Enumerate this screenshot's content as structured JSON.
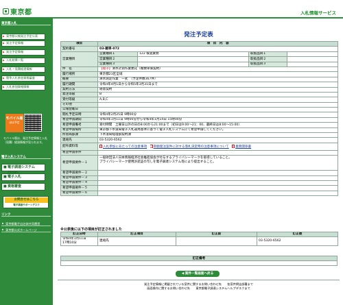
{
  "header": {
    "logo_text": "東京都",
    "service_title": "入札情報サービス"
  },
  "sidebar": {
    "section1_label": "東京都入札",
    "items": [
      "東京都公報発注予定公表",
      "発注予定情報",
      "発注予定情報",
      "入札結果一覧",
      "入札・見積経過情報",
      "競争入札参加資格審査",
      "入札参加資格情報"
    ],
    "mobile_label": "モバイル版",
    "mobile_sub": "ほぼ予定",
    "note": "モバイル版は、発注予定情報と入札（見積）経過情報が見られます。",
    "section2_label": "電子入札システム",
    "big_items": [
      "電子調達システム(TOP)",
      "電子入札",
      "資格審査"
    ],
    "banner_title": "お問合せはこちら",
    "banner_sub": "電子調達サポートデスク",
    "section3_label": "リンク",
    "links": [
      "東京都電子自治体共同運営",
      "東京都公式ホームページ"
    ]
  },
  "main": {
    "page_title": "発注予定表",
    "header_item": "項目",
    "header_content": "項　目　内　容",
    "contract_no_label": "契約番号",
    "contract_no": "03-雑単-072",
    "business_type_label": "営業種目",
    "business_rows": [
      {
        "k": "営業種目１",
        "v": "122 検査業務",
        "k2": "取扱品目１",
        "v2": ""
      },
      {
        "k": "営業種目２",
        "v": "",
        "k2": "取扱品目２",
        "v2": ""
      },
      {
        "k": "営業種目３",
        "v": "",
        "k2": "取扱品目３",
        "v2": ""
      }
    ],
    "subject_label": "件　名",
    "subject_tag": "【電子】",
    "subject": "清水計測作業委託（複数単価契約）",
    "location_label": "履行場所",
    "location": "東京都23区全域",
    "summary_label": "概要",
    "summary": "清水測定作業　一式　（予定件数367件）",
    "period_label": "履行期間",
    "period": "令和4年4月1日から令和5年3月31日まで",
    "method_label": "契約方法",
    "method": "随意契約",
    "rank_label": "発注等級",
    "rank": "B",
    "accept_label": "受付等級",
    "accept": "A,B,C",
    "other_label": "その他",
    "other": "",
    "publish_label": "公報登載日",
    "publish": "",
    "open_label": "閲札予定日時",
    "open": "令和4年2月25日 9時00分",
    "apply_label": "希望申請期間",
    "apply": "令和4年1月11日 9時00分から令和4年1月14日 15時00分",
    "apply_note_label": "希望申請備考",
    "apply_note": "受付時間　土曜日以外の日の8:00から21:00まで（初日は9:00〜21：00、最終日は8:00〜15:00）",
    "apply_place_label": "希望申請場所",
    "apply_place": "東京都下水道局電子入札運用基準に基づく電子入札システムにて希望申請してください。",
    "office_label": "所管局部課",
    "office": "下水道局経理部契約課",
    "contact_label": "連絡先",
    "contact": "03-5320-6562",
    "docs_label": "配布資料等",
    "docs": [
      "入札参加にあたっての注意事項",
      "単額発注案件に対する落札決定時の注意事項について",
      "業務関係書"
    ],
    "cond_label": "希望申請条件",
    "cond": "",
    "req1_label": "希望申請要件－１",
    "req1_lines": [
      "一般財団法人日本情報経済社会推進協会が付与するプライバシーマークを取得していること。",
      "プライバシーマーク使用許諾証の写しを電子調達システム等により提出すること。"
    ],
    "req_labels": [
      "希望申請要件－２",
      "希望申請要件－３",
      "希望申請要件－４",
      "希望申請要件－５",
      "希望申請要件－６"
    ]
  },
  "correction": {
    "title": "※公表後に以下の項目が訂正されました",
    "headers": [
      "訂正日時",
      "訂正項目",
      "訂正前",
      "訂正後"
    ],
    "date_line1": "令和4年1月11日",
    "date_line2": "17時10分",
    "item": "連絡先",
    "before": "",
    "after": "03-5320-6562"
  },
  "remark": {
    "header": "訂正備考",
    "value": ""
  },
  "back_button": "◀ 案件一覧画面へ戻る",
  "footer": {
    "line1": "発注予定情報に掲載されている案件に関するお問い合わせ先　　各案件掲出部署まで",
    "line2": "画面操作に関するお問い合わせ先　　東京都電子調達システムヘルプデスクまで"
  }
}
